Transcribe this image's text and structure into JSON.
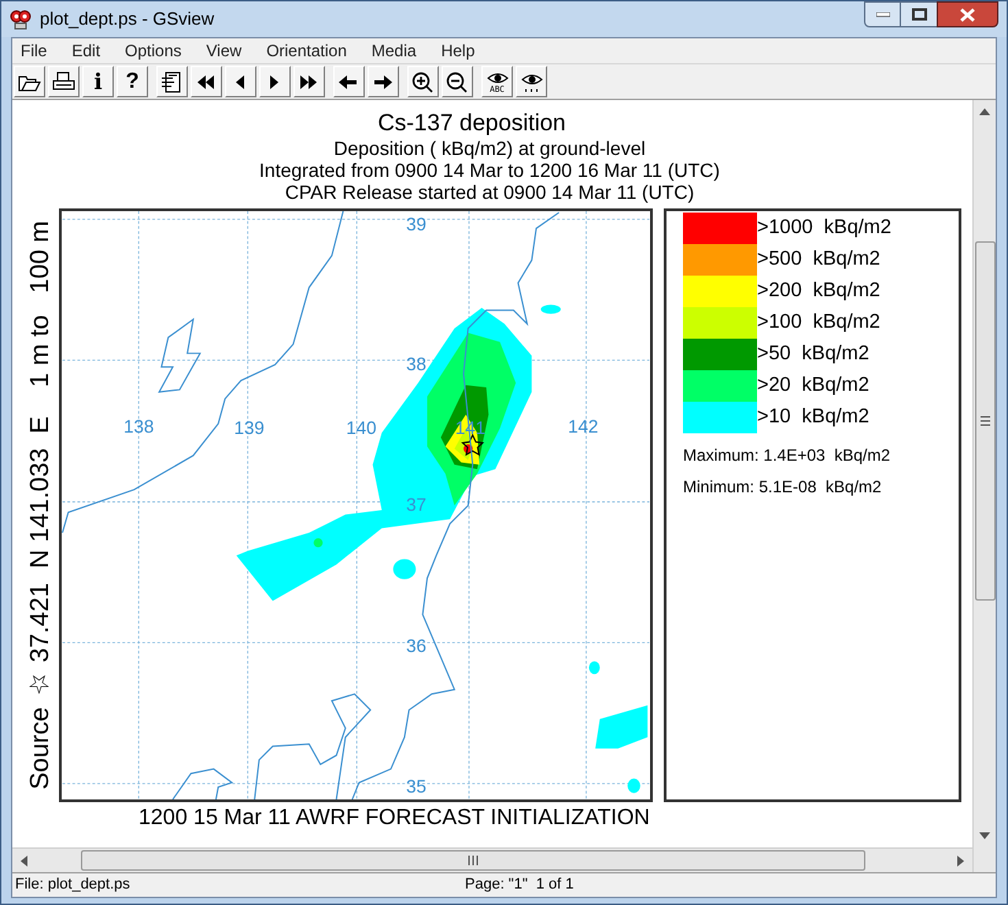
{
  "window": {
    "title": "plot_dept.ps - GSview"
  },
  "menu": [
    "File",
    "Edit",
    "Options",
    "View",
    "Orientation",
    "Media",
    "Help"
  ],
  "toolbar": [
    {
      "kind": "open"
    },
    {
      "kind": "print"
    },
    {
      "kind": "info",
      "glyph": "i"
    },
    {
      "kind": "help",
      "glyph": "?"
    },
    {
      "kind": "page",
      "group_start": true
    },
    {
      "kind": "first"
    },
    {
      "kind": "prev"
    },
    {
      "kind": "next"
    },
    {
      "kind": "last"
    },
    {
      "kind": "back",
      "group_start": true
    },
    {
      "kind": "forward"
    },
    {
      "kind": "zoom-in",
      "group_start": true
    },
    {
      "kind": "zoom-out"
    },
    {
      "kind": "eye-text",
      "glyph": "ABC",
      "group_start": true
    },
    {
      "kind": "eye-dots"
    }
  ],
  "plot": {
    "title": "Cs-137 deposition",
    "subtitles": [
      "Deposition  ( kBq/m2) at ground-level",
      "Integrated from 0900 14 Mar to 1200 16 Mar 11 (UTC)",
      "CPAR Release started at 0900 14 Mar 11 (UTC)"
    ],
    "side_label": "Source ☆ 37.421  N 141.033  E    1 m to   100 m",
    "footer": "1200 15 Mar 11 AWRF FORECAST INITIALIZATION",
    "map": {
      "lon_labels": [
        "138",
        "139",
        "140",
        "141",
        "142"
      ],
      "lat_labels": [
        "39",
        "38",
        "37",
        "36",
        "35"
      ]
    },
    "legend": {
      "items": [
        {
          "label": ">1000  kBq/m2",
          "color": "#ff0000"
        },
        {
          "label": ">500  kBq/m2",
          "color": "#ff9900"
        },
        {
          "label": ">200  kBq/m2",
          "color": "#ffff00"
        },
        {
          "label": ">100  kBq/m2",
          "color": "#ccff00"
        },
        {
          "label": ">50  kBq/m2",
          "color": "#009900"
        },
        {
          "label": ">20  kBq/m2",
          "color": "#00ff66"
        },
        {
          "label": ">10  kBq/m2",
          "color": "#00ffff"
        }
      ],
      "maximum": "Maximum: 1.4E+03  kBq/m2",
      "minimum": "Minimum: 5.1E-08  kBq/m2"
    }
  },
  "status_bar": {
    "file": "File: plot_dept.ps",
    "page": "Page: \"1\"  1 of 1"
  }
}
